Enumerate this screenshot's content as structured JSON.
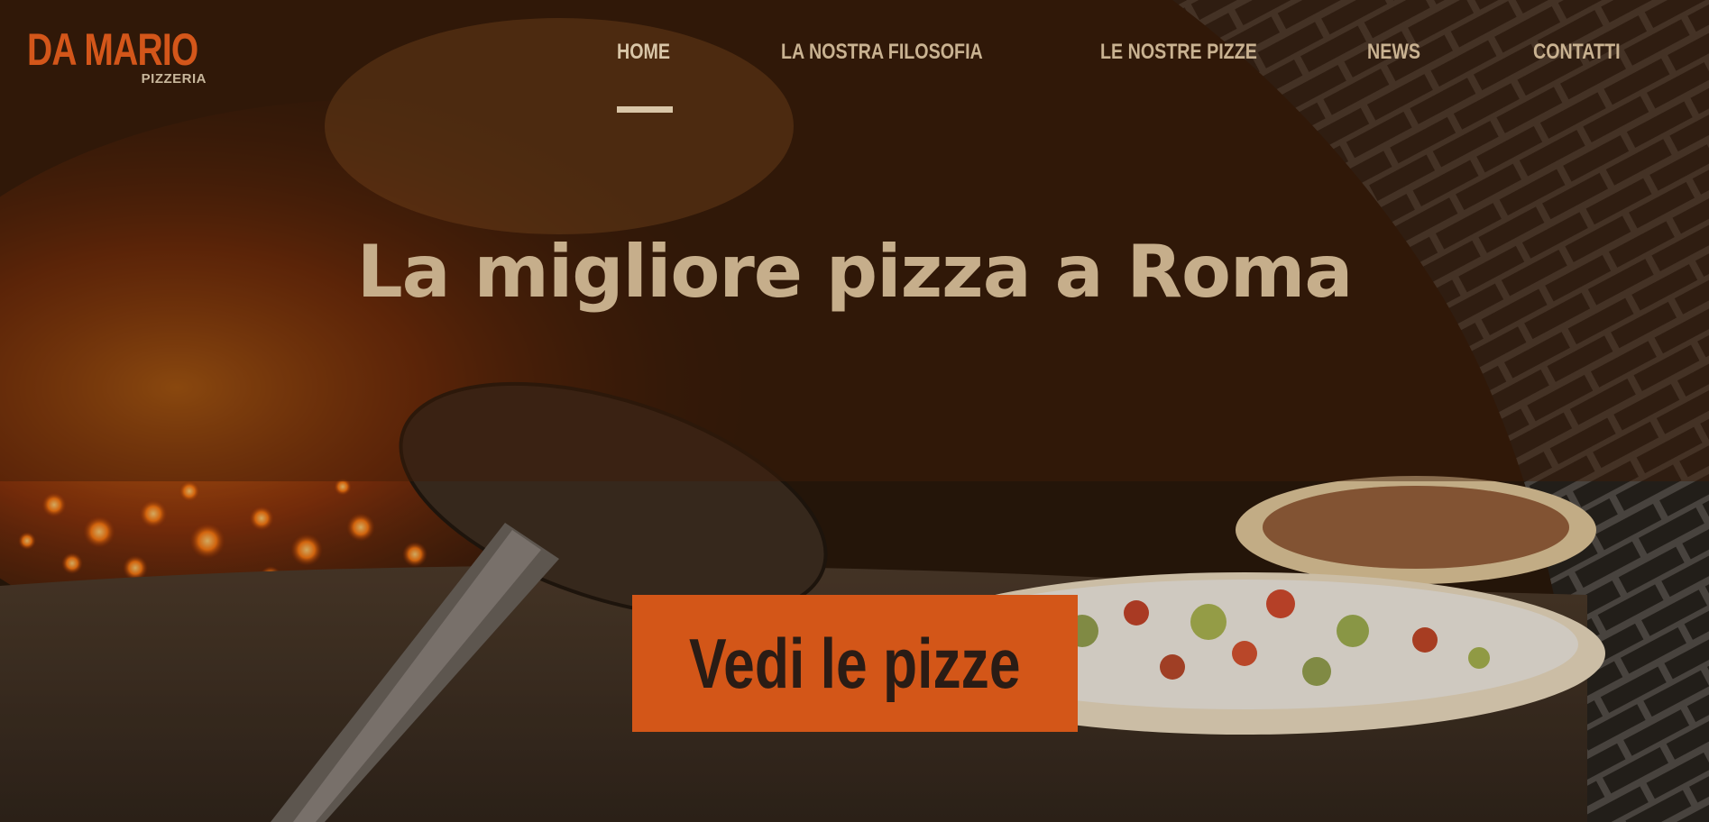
{
  "logo": {
    "title": "DA MARIO",
    "subtitle": "PIZZERIA"
  },
  "nav": {
    "items": [
      {
        "label": "HOME",
        "active": true
      },
      {
        "label": "LA NOSTRA FILOSOFIA",
        "active": false
      },
      {
        "label": "LE NOSTRE PIZZE",
        "active": false
      },
      {
        "label": "NEWS",
        "active": false
      },
      {
        "label": "CONTATTI",
        "active": false
      }
    ]
  },
  "hero": {
    "headline": "La migliore pizza a Roma",
    "cta_label": "Vedi le pizze",
    "background_image": "wood-fired-pizza-oven-photo"
  },
  "colors": {
    "brand_orange": "#d3561a",
    "nav_text": "#c9b291",
    "headline_text": "#c6ae8b",
    "cta_bg": "#d35618",
    "cta_text": "#2a1c15"
  }
}
